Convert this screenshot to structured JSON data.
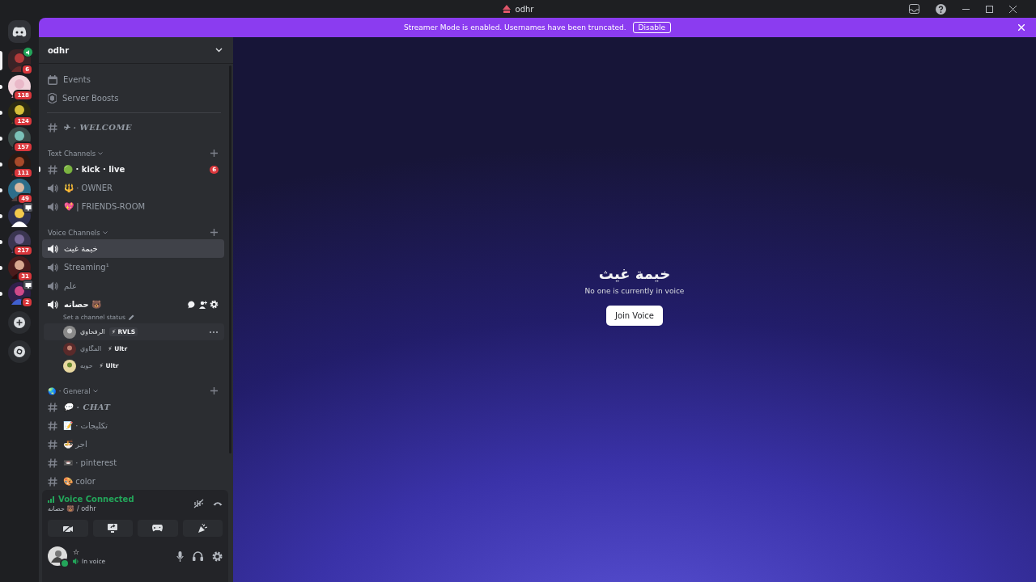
{
  "window": {
    "title": "odhr"
  },
  "banner": {
    "text": "Streamer Mode is enabled. Usernames have been truncated.",
    "button": "Disable"
  },
  "servers": [
    {
      "badge": "6",
      "selected": true,
      "unread": false,
      "kind": "voice"
    },
    {
      "badge": "118",
      "selected": false,
      "unread": true,
      "kind": "plain"
    },
    {
      "badge": "124",
      "selected": false,
      "unread": true,
      "kind": "plain"
    },
    {
      "badge": "157",
      "selected": false,
      "unread": true,
      "kind": "plain"
    },
    {
      "badge": "111",
      "selected": false,
      "unread": true,
      "kind": "plain"
    },
    {
      "badge": "49",
      "selected": false,
      "unread": true,
      "kind": "plain"
    },
    {
      "selected": false,
      "unread": true,
      "kind": "screen"
    },
    {
      "badge": "217",
      "selected": false,
      "unread": true,
      "kind": "plain"
    },
    {
      "badge": "31",
      "selected": false,
      "unread": true,
      "kind": "plain"
    },
    {
      "badge": "2",
      "selected": false,
      "unread": true,
      "kind": "screen"
    }
  ],
  "server": {
    "name": "odhr"
  },
  "menu": [
    {
      "label": "Events",
      "kind": "events"
    },
    {
      "label": "Server Boosts",
      "kind": "boosts"
    }
  ],
  "pinned": [
    {
      "kind": "text",
      "name": "✈ · WELCOME",
      "selected": false,
      "unread": false
    }
  ],
  "categories": [
    {
      "name": "Text Channels",
      "channels": [
        {
          "kind": "text",
          "name": "🟢 · kick · live",
          "selected": false,
          "unread": true,
          "badge": "6"
        },
        {
          "kind": "voice",
          "name": "🔱 · OWNER",
          "selected": false,
          "unread": false
        },
        {
          "kind": "voice",
          "name": "💖 | FRIENDS-ROOM",
          "selected": false,
          "unread": false
        }
      ]
    },
    {
      "name": "Voice Channels",
      "channels": [
        {
          "kind": "voice",
          "name": "خيمة غيث",
          "selected": true,
          "unread": false
        },
        {
          "kind": "voice",
          "name": "Streaming¹",
          "selected": false,
          "unread": false
        },
        {
          "kind": "voice",
          "name": "علم",
          "selected": false,
          "unread": false
        },
        {
          "kind": "voice",
          "name": "حصانه 🐻",
          "selected": false,
          "unread": true,
          "status": "Set a channel status",
          "members": [
            {
              "name": "الرفحاوي",
              "tag": "⚡ RVLS",
              "selected": true
            },
            {
              "name": "المگاوي",
              "tag": "⚡ Ultr",
              "selected": false
            },
            {
              "name": "حويه",
              "tag": "⚡ Ultr",
              "selected": false
            }
          ]
        }
      ]
    },
    {
      "name": "🌏 · General",
      "channels": [
        {
          "kind": "text",
          "name": "💬 · CHAT",
          "selected": false,
          "unread": false
        },
        {
          "kind": "text",
          "name": "📝 · تكليجات",
          "selected": false,
          "unread": false
        },
        {
          "kind": "text",
          "name": "🍜 اجر",
          "selected": false,
          "unread": false
        },
        {
          "kind": "text",
          "name": "📼 · pinterest",
          "selected": false,
          "unread": false
        },
        {
          "kind": "text",
          "name": "🎨 color",
          "selected": false,
          "unread": false
        }
      ]
    }
  ],
  "voice_panel": {
    "title": "Voice Connected",
    "location": "حصانه 🐻 / odhr"
  },
  "user": {
    "name": "☆",
    "status": "In voice"
  },
  "stage": {
    "title": "خيمة غيث",
    "subtitle": "No one is currently in voice",
    "button": "Join Voice"
  }
}
